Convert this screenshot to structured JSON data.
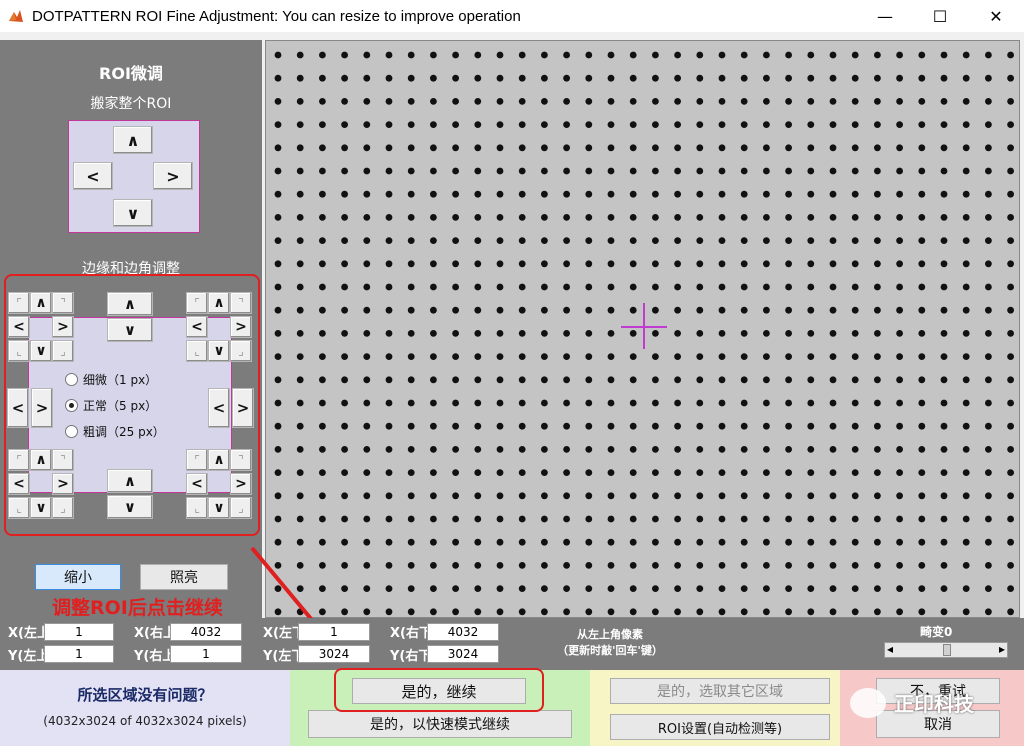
{
  "window": {
    "title": "DOTPATTERN ROI Fine Adjustment: You can resize to improve operation",
    "minimize": "—",
    "maximize": "☐",
    "close": "✕"
  },
  "left_panel": {
    "heading": "ROI微调",
    "move_label": "搬家整个ROI",
    "edge_label": "边缘和边角调整",
    "arrows": {
      "up": "∧",
      "down": "∨",
      "left": "<",
      "right": ">",
      "nw": "⌜",
      "ne": "⌝",
      "sw": "⌞",
      "se": "⌟"
    },
    "step_options": [
      {
        "label": "细微（1 px）",
        "selected": false
      },
      {
        "label": "正常（5 px）",
        "selected": true
      },
      {
        "label": "粗调（25 px）",
        "selected": false
      }
    ],
    "shrink_button": "缩小",
    "highlight_button": "照亮",
    "annotation": "调整ROI后点击继续"
  },
  "coords": {
    "x_left_label": "X(左上)",
    "x_left": "1",
    "x_right_label": "X(右上)",
    "x_right": "4032",
    "x_left2_label": "X(左下)",
    "x_left2": "1",
    "x_right2_label": "X(右下)",
    "x_right2": "4032",
    "y_left_label": "Y(左上)",
    "y_left": "1",
    "y_right_label": "Y(右上)",
    "y_right": "1",
    "y_left2_label": "Y(左下)",
    "y_left2": "3024",
    "y_right2_label": "Y(右下)",
    "y_right2": "3024",
    "info_line1": "从左上角像素",
    "info_line2": "（更新时敲'回车'键）",
    "distortion_label": "畸变0",
    "slider_left": "◂",
    "slider_right": "▸"
  },
  "confirm": {
    "question": "所选区域没有问题？",
    "dimensions": "(4032x3024 of 4032x3024 pixels)",
    "yes_continue": "是的，继续",
    "yes_fast": "是的，以快速模式继续",
    "yes_other": "是的，选取其它区域",
    "roi_settings": "ROI设置(自动检测等)",
    "no_retry": "不，重试",
    "cancel": "取消",
    "watermark": "正印科技"
  },
  "colors": {
    "panel_gray": "#7c7c7c",
    "roi_pink": "#c0399a",
    "annotation_red": "#e02020",
    "confirm_blue": "#e3e2f5",
    "confirm_green": "#c9f0b8",
    "confirm_yellow": "#f7f5c6",
    "confirm_pink": "#f6c8c8"
  }
}
